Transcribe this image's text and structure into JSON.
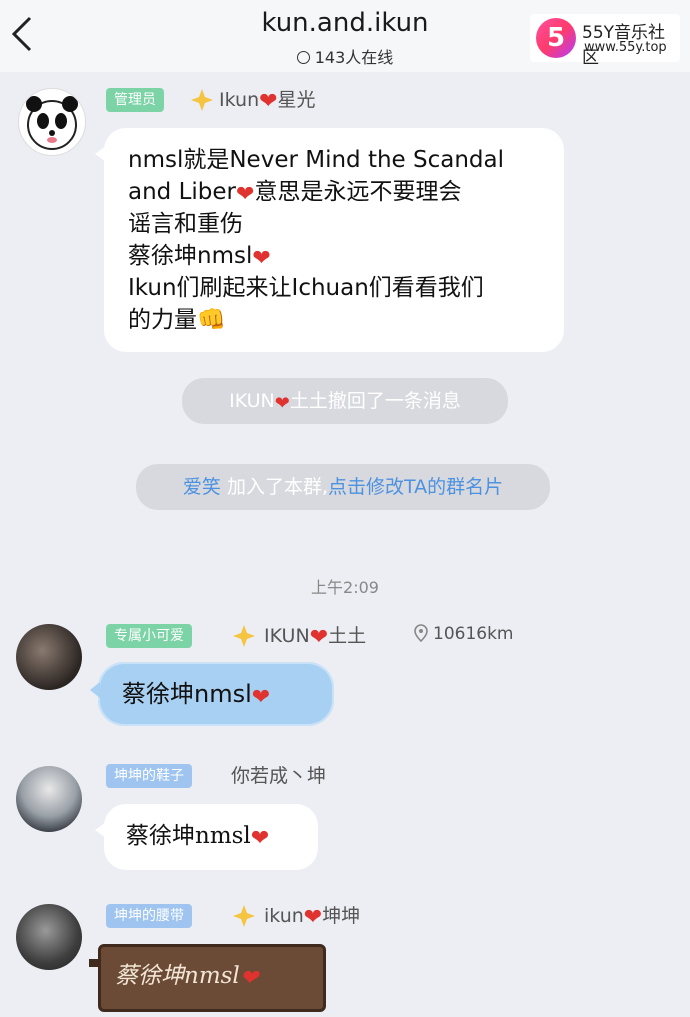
{
  "header": {
    "title": "kun.and.ikun",
    "online": "143人在线",
    "back_icon": "chevron-left-icon"
  },
  "watermark": {
    "logo": "5",
    "name": "55Y音乐社区",
    "url": "www.55y.top"
  },
  "colors": {
    "background": "#eceef3",
    "tag_green": "#7bd3a6",
    "tag_blue": "#9ec4ef",
    "link": "#4c92e0",
    "heart": "#e0332f",
    "bubble_blue": "#a8d0f3"
  },
  "messages": [
    {
      "tag": "管理员",
      "name_prefix": "Ikun",
      "name_suffix": "星光",
      "lines": [
        "nmsl就是Never Mind the Scandal",
        "and Liber",
        "意思是永远不要理会",
        "谣言和重伤",
        "蔡徐坤nmsl",
        "Ikun们刷起来让Ichuan们看看我们",
        "的力量"
      ]
    },
    {
      "tag": "专属小可爱",
      "name_prefix": "IKUN",
      "name_suffix": "土土",
      "distance": "10616km",
      "text": "蔡徐坤nmsl"
    },
    {
      "tag": "坤坤的鞋子",
      "name": "你若成丶坤",
      "text": "蔡徐坤nmsl"
    },
    {
      "tag": "坤坤的腰带",
      "name_prefix": "ikun",
      "name_suffix": "坤坤",
      "text": "蔡徐坤nmsl"
    }
  ],
  "notices": {
    "recall_name": "IKUN",
    "recall_text": "土土撤回了一条消息",
    "join_name": "爱笑",
    "join_text": "加入了本群,",
    "join_link": "点击修改TA的群名片"
  },
  "timestamp": "上午2:09"
}
